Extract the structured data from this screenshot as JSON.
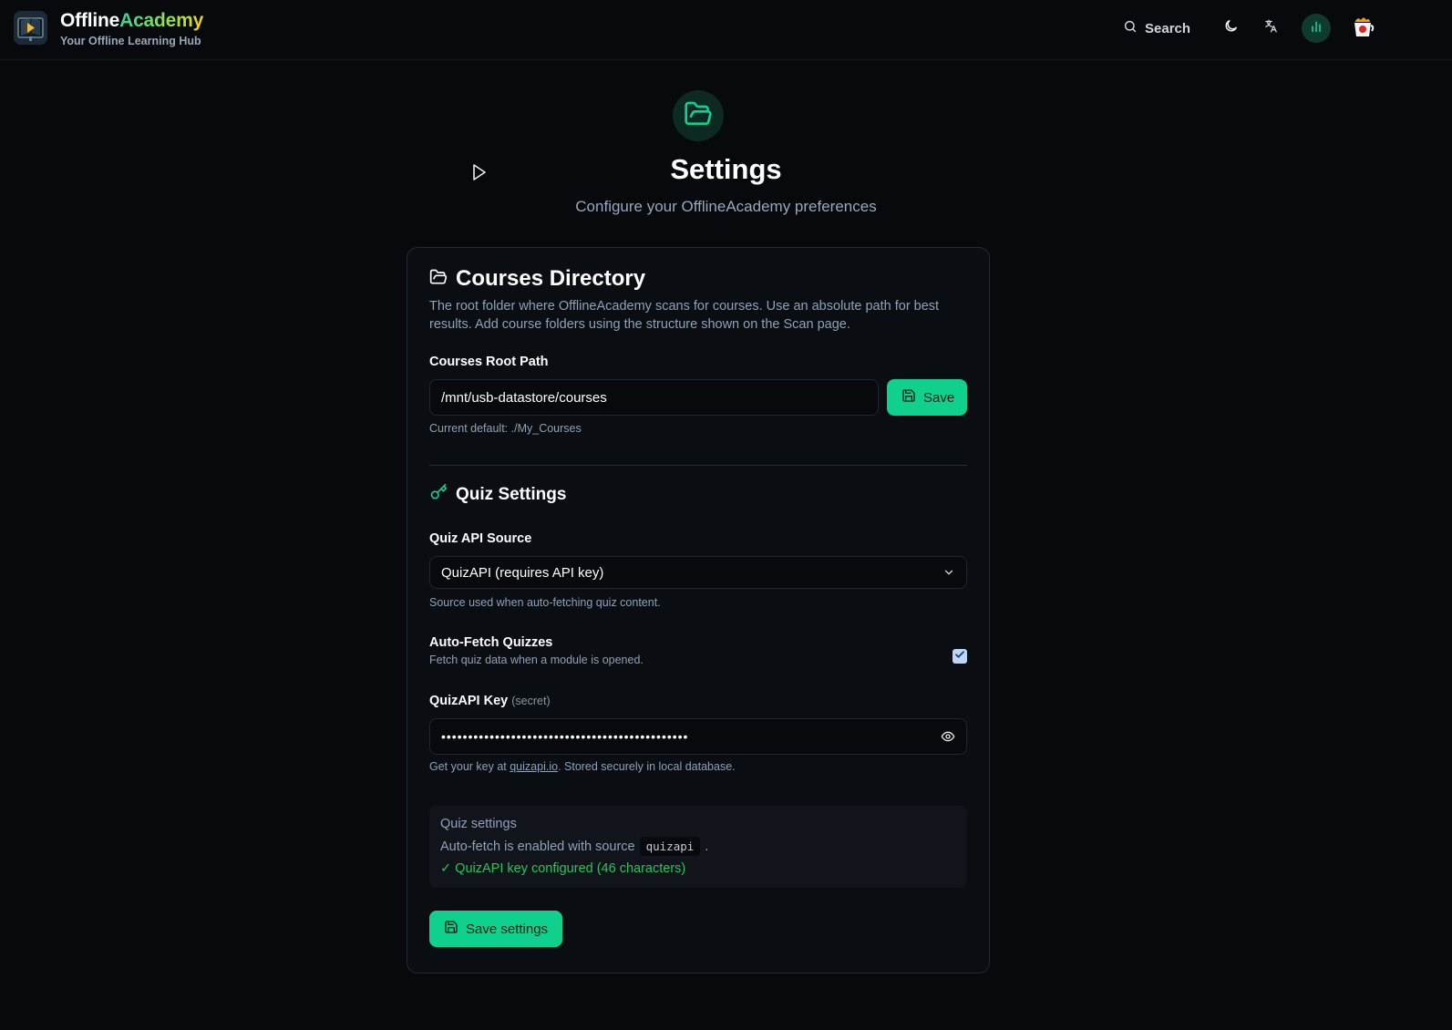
{
  "header": {
    "brand_part1": "Offline",
    "brand_part2": "Academy",
    "brand_subtitle": "Your Offline Learning Hub",
    "search_label": "Search",
    "icons": [
      "logo-icon",
      "search-icon",
      "moon-icon",
      "translate-icon",
      "bar-chart-icon",
      "coffee-cup-icon"
    ]
  },
  "page": {
    "hero_icon": "folder-open-icon",
    "title": "Settings",
    "subtitle": "Configure your OfflineAcademy preferences"
  },
  "courses": {
    "title": "Courses Directory",
    "description": "The root folder where OfflineAcademy scans for courses. Use an absolute path for best results. Add course folders using the structure shown on the Scan page.",
    "path_label": "Courses Root Path",
    "path_value": "/mnt/usb-datastore/courses",
    "save_label": "Save",
    "default_hint": "Current default: ./My_Courses"
  },
  "quiz": {
    "title": "Quiz Settings",
    "source_label": "Quiz API Source",
    "source_value": "QuizAPI (requires API key)",
    "source_hint": "Source used when auto-fetching quiz content.",
    "autofetch_label": "Auto-Fetch Quizzes",
    "autofetch_hint": "Fetch quiz data when a module is opened.",
    "autofetch_checked": true,
    "key_label": "QuizAPI Key",
    "key_secret_tag": "(secret)",
    "key_masked": "••••••••••••••••••••••••••••••••••••••••••••••",
    "key_hint_prefix": "Get your key at ",
    "key_hint_link": "quizapi.io",
    "key_hint_suffix": ". Stored securely in local database.",
    "info_title": "Quiz settings",
    "info_autofetch_prefix": "Auto-fetch is enabled with source",
    "info_source_code": "quizapi",
    "info_autofetch_suffix": ".",
    "info_key_status": "✓ QuizAPI key configured (46 characters)",
    "save_settings_label": "Save settings"
  },
  "colors": {
    "accent": "#10d08e",
    "background": "#07090c",
    "card": "#0a0d11",
    "success": "#22c55e"
  }
}
